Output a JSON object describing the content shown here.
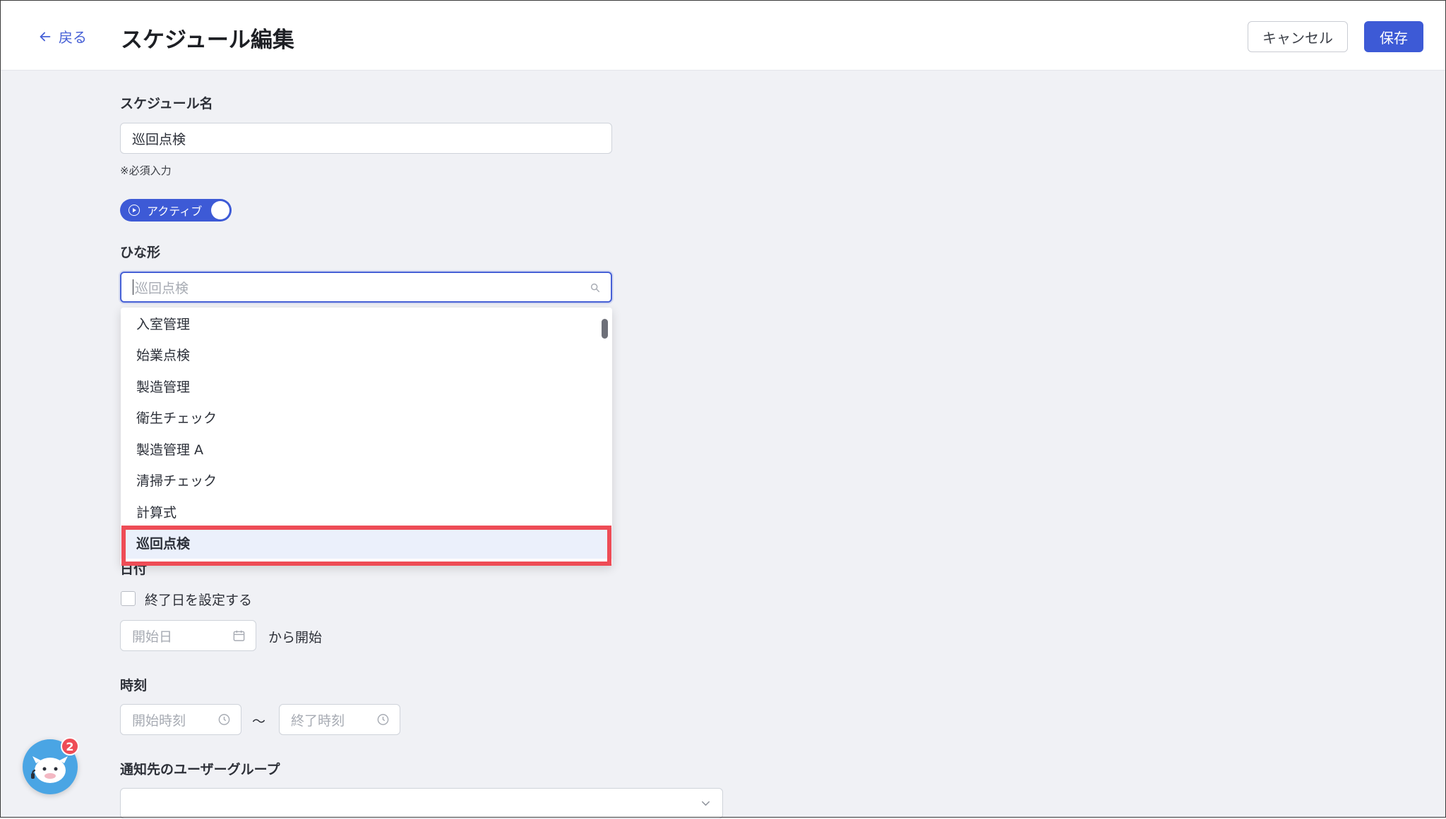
{
  "header": {
    "back_label": "戻る",
    "title": "スケジュール編集",
    "cancel_label": "キャンセル",
    "save_label": "保存"
  },
  "form": {
    "name_label": "スケジュール名",
    "name_value": "巡回点検",
    "required_note": "※必須入力",
    "active_label": "アクティブ",
    "template_label": "ひな形",
    "template_placeholder": "巡回点検",
    "template_options": [
      "入室管理",
      "始業点検",
      "製造管理",
      "衛生チェック",
      "製造管理 A",
      "清掃チェック",
      "計算式",
      "巡回点検"
    ],
    "template_selected": "巡回点検",
    "date_label": "日付",
    "end_date_checkbox_label": "終了日を設定する",
    "start_date_placeholder": "開始日",
    "start_suffix": "から開始",
    "time_label": "時刻",
    "start_time_placeholder": "開始時刻",
    "time_separator": "〜",
    "end_time_placeholder": "終了時刻",
    "notify_label": "通知先のユーザーグループ"
  },
  "chat": {
    "badge_count": "2"
  },
  "colors": {
    "accent": "#3d5ad6",
    "highlight": "#ee4c56",
    "background": "#f0f1f5"
  }
}
